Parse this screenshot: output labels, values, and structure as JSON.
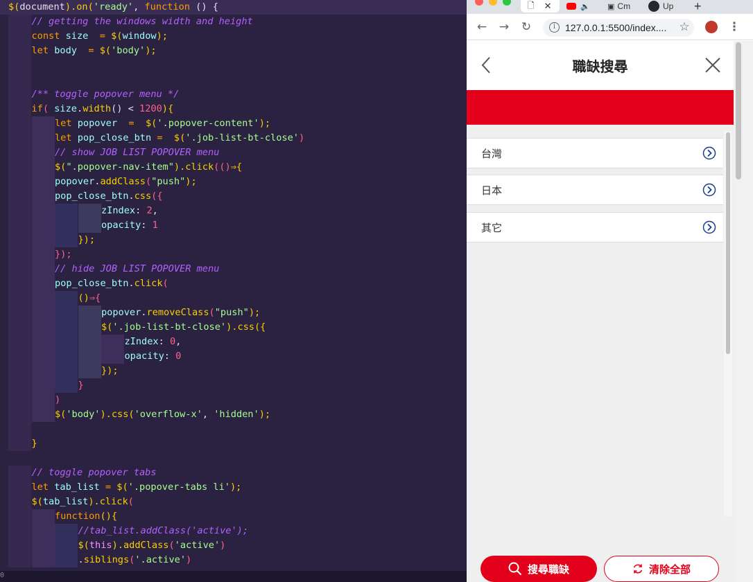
{
  "editor": {
    "lines": [
      [
        {
          "t": "$(",
          "c": "c-fn"
        },
        {
          "t": "document",
          "c": "c-plain"
        },
        {
          "t": ").",
          "c": "c-fn"
        },
        {
          "t": "on",
          "c": "c-fn"
        },
        {
          "t": "(",
          "c": "c-fn"
        },
        {
          "t": "'ready'",
          "c": "c-str"
        },
        {
          "t": ", ",
          "c": "c-plain"
        },
        {
          "t": "function",
          "c": "c-kw"
        },
        {
          "t": " () {",
          "c": "c-plain"
        }
      ],
      [
        {
          "t": "// getting the windows width and height",
          "c": "c-cmt"
        }
      ],
      [
        {
          "t": "const",
          "c": "c-kw"
        },
        {
          "t": " size ",
          "c": "c-var"
        },
        {
          "t": " = ",
          "c": "c-kw"
        },
        {
          "t": "$(",
          "c": "c-fn"
        },
        {
          "t": "window",
          "c": "c-var"
        },
        {
          "t": ");",
          "c": "c-fn"
        }
      ],
      [
        {
          "t": "let",
          "c": "c-kw"
        },
        {
          "t": " body ",
          "c": "c-var"
        },
        {
          "t": " = ",
          "c": "c-kw"
        },
        {
          "t": "$(",
          "c": "c-fn"
        },
        {
          "t": "'body'",
          "c": "c-str"
        },
        {
          "t": ");",
          "c": "c-fn"
        }
      ],
      [],
      [],
      [
        {
          "t": "/** toggle popover menu */",
          "c": "c-cmt"
        }
      ],
      [
        {
          "t": "if",
          "c": "c-kw"
        },
        {
          "t": "( ",
          "c": "c-brk"
        },
        {
          "t": "size",
          "c": "c-var"
        },
        {
          "t": ".",
          "c": "c-plain"
        },
        {
          "t": "width",
          "c": "c-fn"
        },
        {
          "t": "() < ",
          "c": "c-plain"
        },
        {
          "t": "1200",
          "c": "c-num"
        },
        {
          "t": "){",
          "c": "c-fn"
        }
      ],
      [
        {
          "t": "let",
          "c": "c-kw"
        },
        {
          "t": " popover ",
          "c": "c-var"
        },
        {
          "t": " = ",
          "c": "c-kw"
        },
        {
          "t": " $(",
          "c": "c-fn"
        },
        {
          "t": "'.popover-content'",
          "c": "c-str"
        },
        {
          "t": ");",
          "c": "c-fn"
        }
      ],
      [
        {
          "t": "let",
          "c": "c-kw"
        },
        {
          "t": " pop_close_btn ",
          "c": "c-var"
        },
        {
          "t": "= ",
          "c": "c-kw"
        },
        {
          "t": " $(",
          "c": "c-fn"
        },
        {
          "t": "'.job-list-bt-close'",
          "c": "c-str"
        },
        {
          "t": ")",
          "c": "c-brk"
        }
      ],
      [
        {
          "t": "// show JOB LIST POPOVER menu",
          "c": "c-cmt"
        }
      ],
      [
        {
          "t": "$(",
          "c": "c-fn"
        },
        {
          "t": "\".popover-nav-item\"",
          "c": "c-str"
        },
        {
          "t": ").",
          "c": "c-fn"
        },
        {
          "t": "click",
          "c": "c-fn"
        },
        {
          "t": "(()",
          "c": "c-brk"
        },
        {
          "t": "⇒{",
          "c": "c-fn"
        }
      ],
      [
        {
          "t": "popover",
          "c": "c-var"
        },
        {
          "t": ".",
          "c": "c-plain"
        },
        {
          "t": "addClass",
          "c": "c-fn"
        },
        {
          "t": "(",
          "c": "c-brk"
        },
        {
          "t": "\"push\"",
          "c": "c-str"
        },
        {
          "t": ");",
          "c": "c-fn"
        }
      ],
      [
        {
          "t": "pop_close_btn",
          "c": "c-var"
        },
        {
          "t": ".",
          "c": "c-plain"
        },
        {
          "t": "css",
          "c": "c-fn"
        },
        {
          "t": "({",
          "c": "c-brk"
        }
      ],
      [
        {
          "t": "zIndex",
          "c": "c-var"
        },
        {
          "t": ": ",
          "c": "c-plain"
        },
        {
          "t": "2",
          "c": "c-num"
        },
        {
          "t": ",",
          "c": "c-plain"
        }
      ],
      [
        {
          "t": "opacity",
          "c": "c-var"
        },
        {
          "t": ": ",
          "c": "c-plain"
        },
        {
          "t": "1",
          "c": "c-num"
        }
      ],
      [
        {
          "t": "});",
          "c": "c-fn"
        }
      ],
      [
        {
          "t": "});",
          "c": "c-brk"
        }
      ],
      [
        {
          "t": "// hide JOB LIST POPOVER menu",
          "c": "c-cmt"
        }
      ],
      [
        {
          "t": "pop_close_btn",
          "c": "c-var"
        },
        {
          "t": ".",
          "c": "c-plain"
        },
        {
          "t": "click",
          "c": "c-fn"
        },
        {
          "t": "(",
          "c": "c-brk"
        }
      ],
      [
        {
          "t": "()",
          "c": "c-fn"
        },
        {
          "t": "⇒{",
          "c": "c-brk"
        }
      ],
      [
        {
          "t": "popover",
          "c": "c-var"
        },
        {
          "t": ".",
          "c": "c-plain"
        },
        {
          "t": "removeClass",
          "c": "c-fn"
        },
        {
          "t": "(",
          "c": "c-brk"
        },
        {
          "t": "\"push\"",
          "c": "c-str"
        },
        {
          "t": ");",
          "c": "c-fn"
        }
      ],
      [
        {
          "t": "$(",
          "c": "c-fn"
        },
        {
          "t": "'.job-list-bt-close'",
          "c": "c-str"
        },
        {
          "t": ").",
          "c": "c-fn"
        },
        {
          "t": "css",
          "c": "c-fn"
        },
        {
          "t": "({",
          "c": "c-fn"
        }
      ],
      [
        {
          "t": "zIndex",
          "c": "c-var"
        },
        {
          "t": ": ",
          "c": "c-plain"
        },
        {
          "t": "0",
          "c": "c-num"
        },
        {
          "t": ",",
          "c": "c-plain"
        }
      ],
      [
        {
          "t": "opacity",
          "c": "c-var"
        },
        {
          "t": ": ",
          "c": "c-plain"
        },
        {
          "t": "0",
          "c": "c-num"
        }
      ],
      [
        {
          "t": "});",
          "c": "c-fn"
        }
      ],
      [
        {
          "t": "}",
          "c": "c-brk"
        }
      ],
      [
        {
          "t": ")",
          "c": "c-brk"
        }
      ],
      [
        {
          "t": "$(",
          "c": "c-fn"
        },
        {
          "t": "'body'",
          "c": "c-str"
        },
        {
          "t": ").",
          "c": "c-fn"
        },
        {
          "t": "css",
          "c": "c-fn"
        },
        {
          "t": "(",
          "c": "c-fn"
        },
        {
          "t": "'overflow-x'",
          "c": "c-str"
        },
        {
          "t": ", ",
          "c": "c-plain"
        },
        {
          "t": "'hidden'",
          "c": "c-str"
        },
        {
          "t": ");",
          "c": "c-fn"
        }
      ],
      [],
      [
        {
          "t": "}",
          "c": "c-fn"
        }
      ],
      [],
      [
        {
          "t": "// toggle popover tabs",
          "c": "c-cmt"
        }
      ],
      [
        {
          "t": "let",
          "c": "c-kw"
        },
        {
          "t": " tab_list ",
          "c": "c-var"
        },
        {
          "t": "= ",
          "c": "c-kw"
        },
        {
          "t": "$(",
          "c": "c-fn"
        },
        {
          "t": "'.popover-tabs li'",
          "c": "c-str"
        },
        {
          "t": ");",
          "c": "c-fn"
        }
      ],
      [
        {
          "t": "$(",
          "c": "c-fn"
        },
        {
          "t": "tab_list",
          "c": "c-var"
        },
        {
          "t": ").",
          "c": "c-fn"
        },
        {
          "t": "click",
          "c": "c-fn"
        },
        {
          "t": "(",
          "c": "c-brk"
        }
      ],
      [
        {
          "t": "function",
          "c": "c-kw"
        },
        {
          "t": "(){",
          "c": "c-fn"
        }
      ],
      [
        {
          "t": "//tab_list.addClass('active');",
          "c": "c-cmt"
        }
      ],
      [
        {
          "t": "$(",
          "c": "c-fn"
        },
        {
          "t": "this",
          "c": "c-this"
        },
        {
          "t": ").",
          "c": "c-fn"
        },
        {
          "t": "addClass",
          "c": "c-fn"
        },
        {
          "t": "(",
          "c": "c-brk"
        },
        {
          "t": "'active'",
          "c": "c-str"
        },
        {
          "t": ")",
          "c": "c-brk"
        }
      ],
      [
        {
          "t": ".",
          "c": "c-plain"
        },
        {
          "t": "siblings",
          "c": "c-fn"
        },
        {
          "t": "(",
          "c": "c-brk"
        },
        {
          "t": "'.active'",
          "c": "c-str"
        },
        {
          "t": ")",
          "c": "c-brk"
        }
      ]
    ],
    "status_left": "0"
  },
  "browser": {
    "tabs": [
      {
        "title": "",
        "icon": "document-icon"
      },
      {
        "title": "",
        "icon": "youtube-icon"
      },
      {
        "title": "Cm",
        "icon": "camera-icon"
      },
      {
        "title": "Up",
        "icon": "github-icon"
      }
    ],
    "url": "127.0.0.1:5500/index....",
    "colors": {
      "accent": "#e3001b",
      "editor_bg": "#2b2140"
    }
  },
  "page": {
    "title": "職缺搜尋",
    "items": [
      {
        "label": "台灣"
      },
      {
        "label": "日本"
      },
      {
        "label": "其它"
      }
    ],
    "search_button": "搜尋職缺",
    "clear_button": "清除全部"
  }
}
